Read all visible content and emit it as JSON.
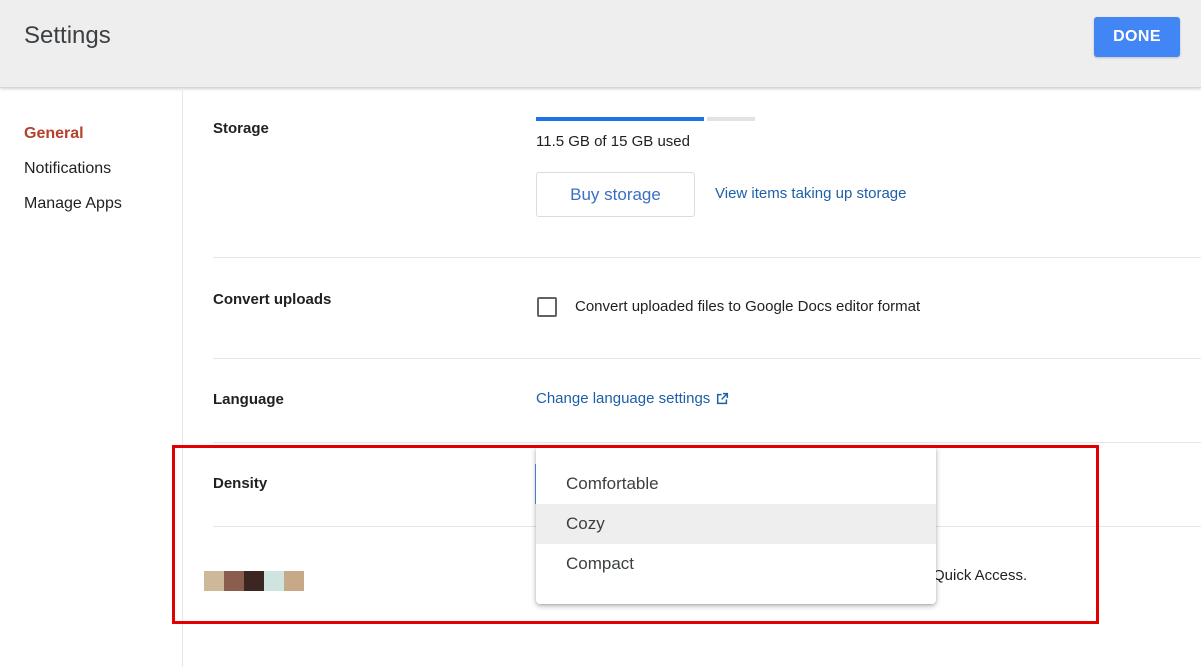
{
  "header": {
    "title": "Settings",
    "done_label": "DONE"
  },
  "sidebar": {
    "items": [
      {
        "label": "General",
        "active": true
      },
      {
        "label": "Notifications",
        "active": false
      },
      {
        "label": "Manage Apps",
        "active": false
      }
    ]
  },
  "storage": {
    "label": "Storage",
    "usage_text": "11.5 GB of 15 GB used",
    "used_gb": 11.5,
    "total_gb": 15,
    "buy_label": "Buy storage",
    "view_link": "View items taking up storage"
  },
  "convert": {
    "label": "Convert uploads",
    "checkbox_label": "Convert uploaded files to Google Docs editor format",
    "checked": false
  },
  "language": {
    "label": "Language",
    "link": "Change language settings",
    "link_icon": "open-in-new-icon"
  },
  "density": {
    "label": "Density",
    "options": [
      "Comfortable",
      "Cozy",
      "Compact"
    ],
    "highlighted": "Cozy"
  },
  "suggestions": {
    "trailing_text": "Quick Access.",
    "swatch_colors": [
      "#cdb99a",
      "#8a5d4c",
      "#3b2622",
      "#cfe3df",
      "#c7a98a"
    ]
  },
  "colors": {
    "accent": "#4285f4",
    "active_nav": "#b3412b",
    "link": "#1d5fa8",
    "highlight_border": "#e00000"
  }
}
